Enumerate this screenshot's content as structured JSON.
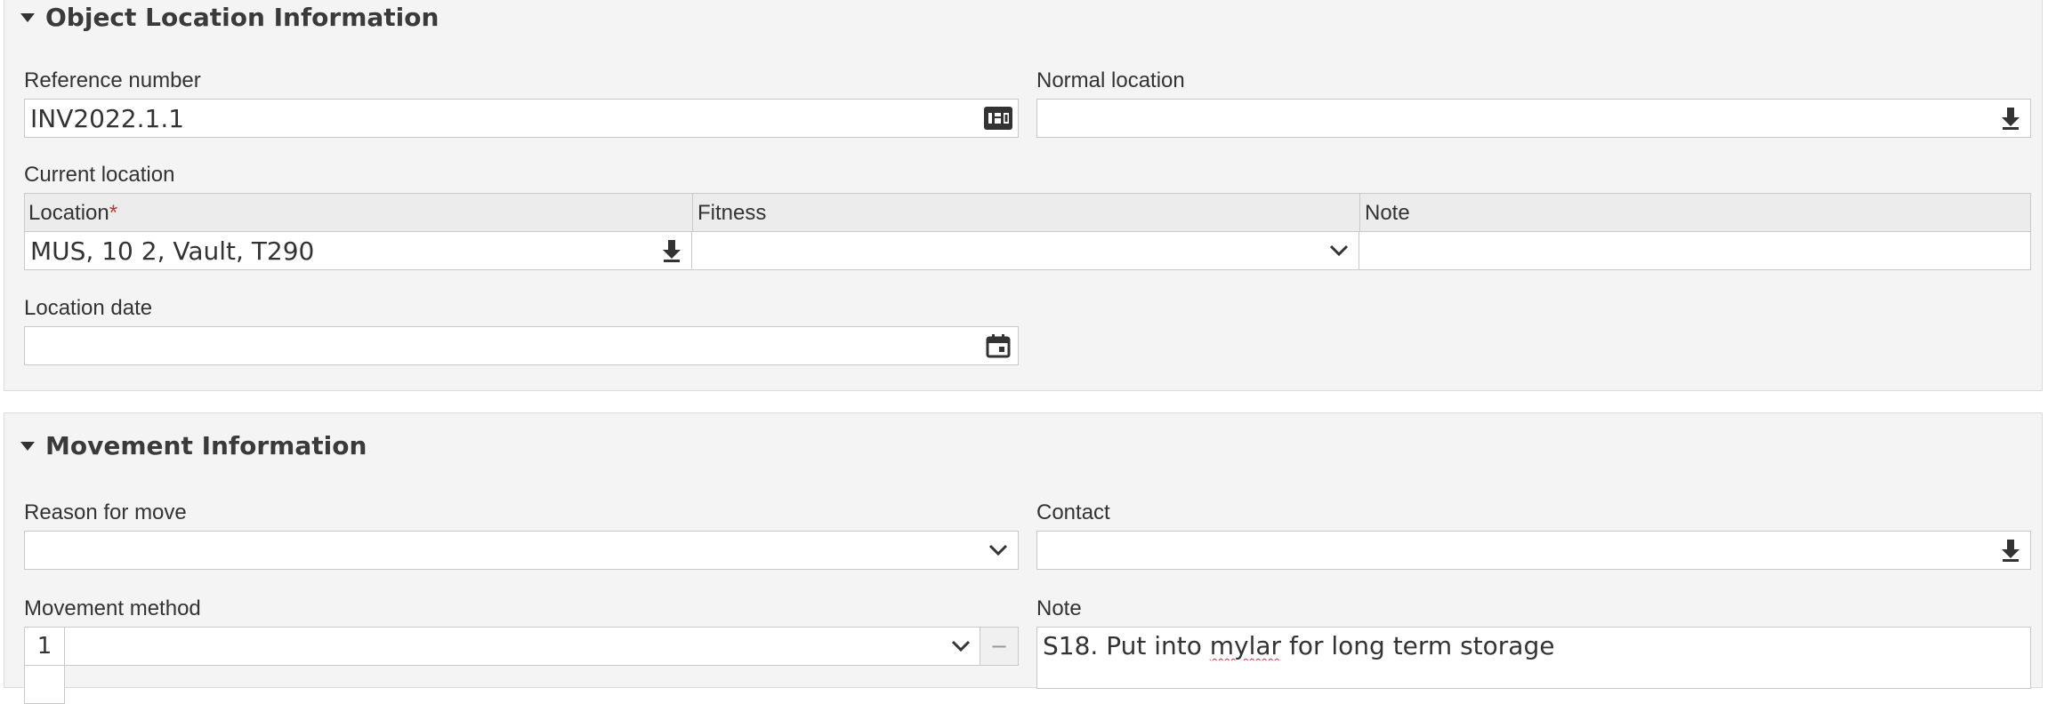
{
  "object_location": {
    "title": "Object Location Information",
    "reference_number": {
      "label": "Reference number",
      "value": "INV2022.1.1"
    },
    "normal_location": {
      "label": "Normal location",
      "value": ""
    },
    "current_location": {
      "label": "Current location",
      "columns": {
        "location": "Location",
        "required_mark": "*",
        "fitness": "Fitness",
        "note": "Note"
      },
      "row": {
        "location": "MUS, 10 2, Vault, T290",
        "fitness": "",
        "note": ""
      }
    },
    "location_date": {
      "label": "Location date",
      "value": ""
    }
  },
  "movement": {
    "title": "Movement Information",
    "reason_for_move": {
      "label": "Reason for move",
      "value": ""
    },
    "contact": {
      "label": "Contact",
      "value": ""
    },
    "movement_method": {
      "label": "Movement method",
      "row_number": "1",
      "value": "",
      "remove_symbol": "−"
    },
    "note": {
      "label": "Note",
      "value_before": "S18. Put into ",
      "misspelled": "mylar",
      "value_after": " for long term storage"
    }
  },
  "icons": {
    "reference_number": "number-generator-icon",
    "lookup": "download-arrow-icon",
    "dropdown": "chevron-down-icon",
    "calendar": "calendar-icon"
  }
}
